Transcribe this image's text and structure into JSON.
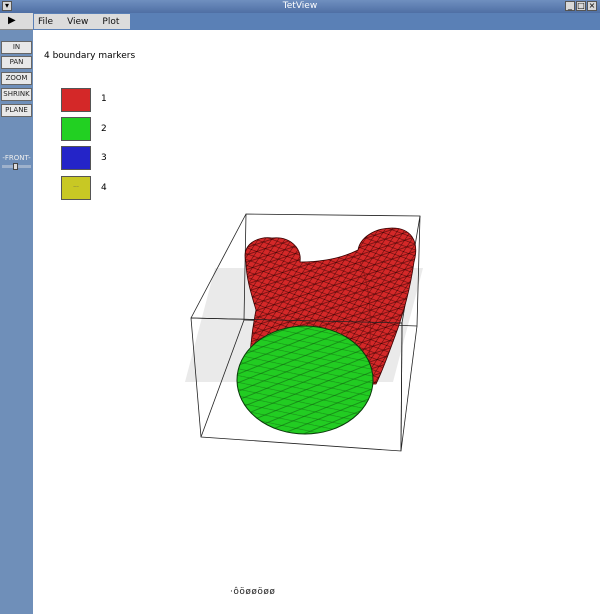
{
  "window": {
    "title": "TetView"
  },
  "toolbar": {
    "play_label": "▶"
  },
  "menu": [
    {
      "label": "File"
    },
    {
      "label": "View"
    },
    {
      "label": "Plot"
    }
  ],
  "sidebar": {
    "buttons": [
      {
        "label": "IN"
      },
      {
        "label": "PAN"
      },
      {
        "label": "ZOOM"
      },
      {
        "label": "SHRINK"
      },
      {
        "label": "PLANE"
      }
    ],
    "slider_label": "-FRONT-"
  },
  "content": {
    "heading": "4 boundary markers",
    "legend": [
      {
        "label": "1",
        "color": "#d42828"
      },
      {
        "label": "2",
        "color": "#22d022"
      },
      {
        "label": "3",
        "color": "#2424c8"
      },
      {
        "label": "4",
        "color": "#c8c824"
      }
    ],
    "swatch_3_dots": "...",
    "status_text": "·ôöøøöøø"
  },
  "colors": {
    "surface_red": "#d42828",
    "cap_green": "#22cc22",
    "wireframe": "#000000",
    "menubar_blue": "#5a80b6"
  }
}
